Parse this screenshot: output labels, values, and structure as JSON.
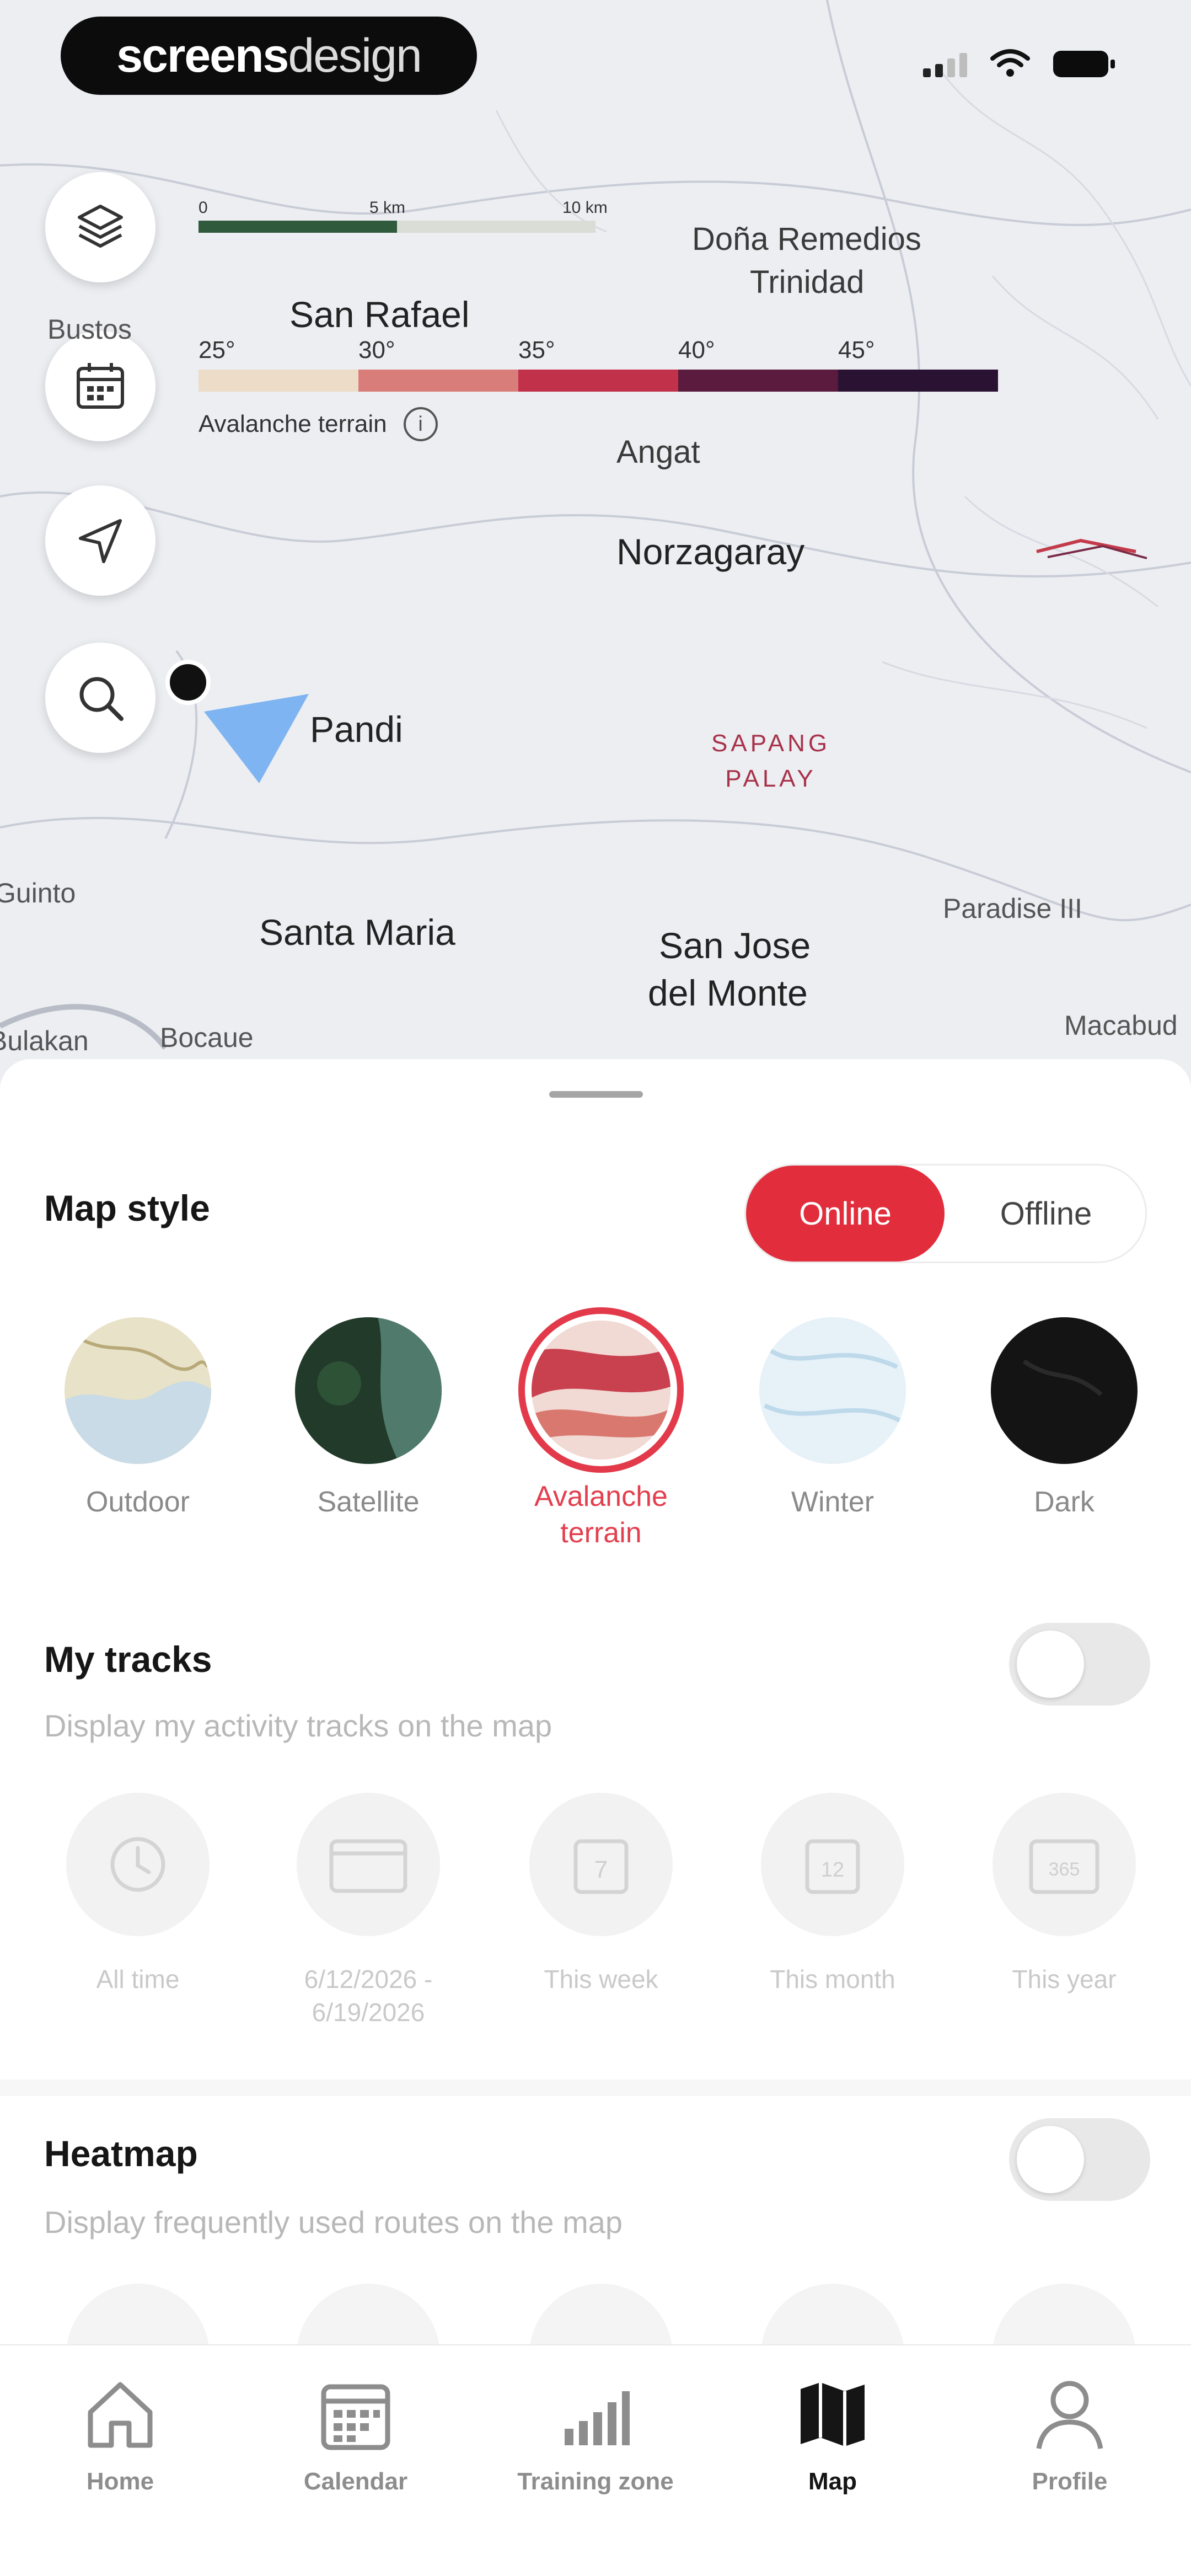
{
  "brand": {
    "bold": "screens",
    "light": "design"
  },
  "map": {
    "scale": {
      "labels": [
        "0",
        "5 km",
        "10 km"
      ]
    },
    "avalanche": {
      "angles": [
        "25°",
        "30°",
        "35°",
        "40°",
        "45°"
      ],
      "colors": [
        "#ecdcc8",
        "#d97d7a",
        "#c2314a",
        "#5a1b3e",
        "#2a1233"
      ],
      "caption": "Avalanche terrain",
      "info_glyph": "i"
    },
    "places": {
      "dona": "Doña Remedios",
      "trinidad": "Trinidad",
      "san_rafael": "San Rafael",
      "bustos": "Bustos",
      "angat": "Angat",
      "norzagaray": "Norzagaray",
      "pandi": "Pandi",
      "sapang": "SAPANG",
      "palay": "PALAY",
      "guinto": "Guinto",
      "santa_maria": "Santa Maria",
      "san_jose": "San Jose",
      "del_monte": "del Monte",
      "paradise": "Paradise III",
      "bulakan": "Bulakan",
      "bocaue": "Bocaue",
      "macabud": "Macabud"
    },
    "buttons": [
      "layers-icon",
      "calendar-icon",
      "navigation-icon",
      "search-icon"
    ]
  },
  "sheet": {
    "map_style": {
      "title": "Map style",
      "online": "Online",
      "offline": "Offline",
      "options": [
        {
          "label": "Outdoor",
          "selected": false
        },
        {
          "label": "Satellite",
          "selected": false
        },
        {
          "label": "Avalanche\nterrain",
          "selected": true
        },
        {
          "label": "Winter",
          "selected": false
        },
        {
          "label": "Dark",
          "selected": false
        }
      ]
    },
    "my_tracks": {
      "title": "My tracks",
      "subtitle": "Display my activity tracks on the map",
      "enabled": false,
      "options": [
        {
          "label": "All time",
          "icon": "clock-icon"
        },
        {
          "label": "6/12/2026 -\n6/19/2026",
          "icon": "date-range-icon"
        },
        {
          "label": "This week",
          "icon": "calendar-7-icon",
          "glyph": "7"
        },
        {
          "label": "This month",
          "icon": "calendar-12-icon",
          "glyph": "12"
        },
        {
          "label": "This year",
          "icon": "calendar-365-icon",
          "glyph": "365"
        }
      ]
    },
    "heatmap": {
      "title": "Heatmap",
      "subtitle": "Display frequently used routes on the map",
      "enabled": false
    }
  },
  "tabs": [
    {
      "label": "Home",
      "icon": "home-icon",
      "active": false
    },
    {
      "label": "Calendar",
      "icon": "calendar-icon",
      "active": false
    },
    {
      "label": "Training zone",
      "icon": "bar-chart-icon",
      "active": false
    },
    {
      "label": "Map",
      "icon": "map-icon",
      "active": true
    },
    {
      "label": "Profile",
      "icon": "profile-icon",
      "active": false
    }
  ]
}
